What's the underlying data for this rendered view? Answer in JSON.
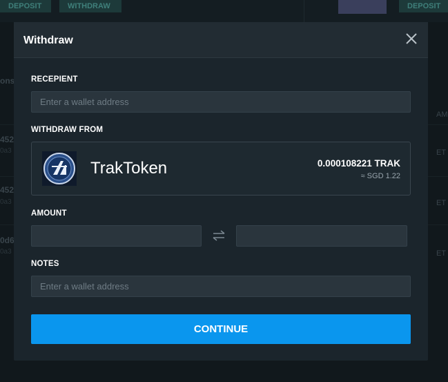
{
  "background": {
    "buttons": [
      "DEPOSIT",
      "WITHDRAW",
      "DEPOSIT"
    ],
    "rows": [
      {
        "main": "452",
        "sub": "0a3",
        "right": "ET"
      },
      {
        "main": "452",
        "sub": "0a3",
        "right": "ET"
      },
      {
        "main": "0d6",
        "sub": "0a3",
        "right": "ET"
      }
    ],
    "side_label": "ons",
    "col_label": "AM"
  },
  "modal": {
    "title": "Withdraw",
    "close_icon": "close-icon"
  },
  "recipient": {
    "label": "RECEPIENT",
    "placeholder": "Enter a wallet address",
    "value": ""
  },
  "withdraw_from": {
    "label": "WITHDRAW FROM",
    "token_name": "TrakToken",
    "balance": "0.000108221 TRAK",
    "fiat": "≈ SGD 1.22",
    "logo_icon": "traktoken-logo-icon"
  },
  "amount": {
    "label": "AMOUNT",
    "crypto_value": "",
    "fiat_value": "",
    "swap_icon": "swap-arrows-icon"
  },
  "notes": {
    "label": "NOTES",
    "placeholder": "Enter a wallet address",
    "value": ""
  },
  "continue_label": "CONTINUE",
  "colors": {
    "accent": "#0a96ee",
    "modal_bg": "#1b252c",
    "input_bg": "#2a353d"
  }
}
